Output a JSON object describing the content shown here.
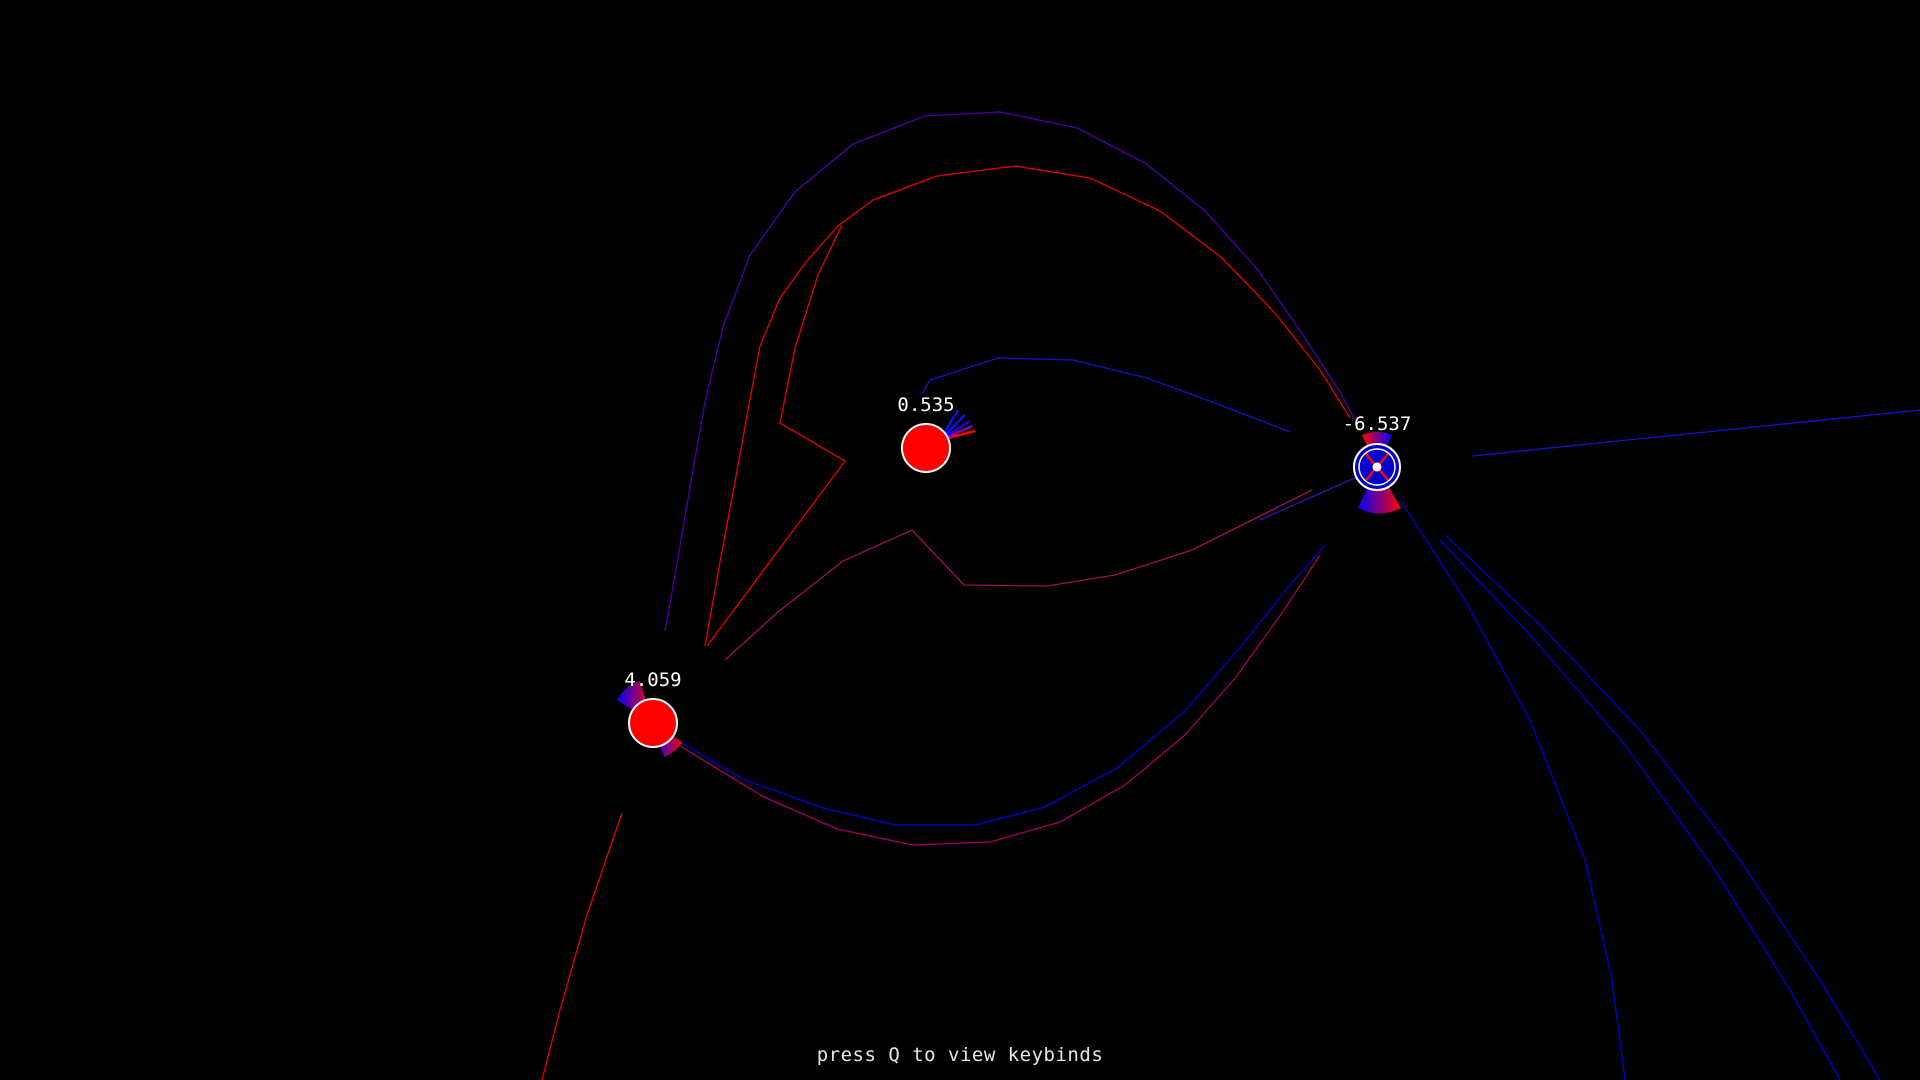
{
  "colors": {
    "background": "#000000",
    "positive": "#ff0000",
    "negative": "#0000cc",
    "mixed": "#5a0090",
    "outline": "#ffffff",
    "text": "#ffffff"
  },
  "charges": [
    {
      "name": "charge-center",
      "label": "0.535",
      "sign": "positive"
    },
    {
      "name": "charge-left",
      "label": "4.059",
      "sign": "positive"
    },
    {
      "name": "charge-right",
      "label": "-6.537",
      "sign": "negative",
      "selected": true
    }
  ],
  "hint": {
    "text": "press Q to view keybinds"
  }
}
